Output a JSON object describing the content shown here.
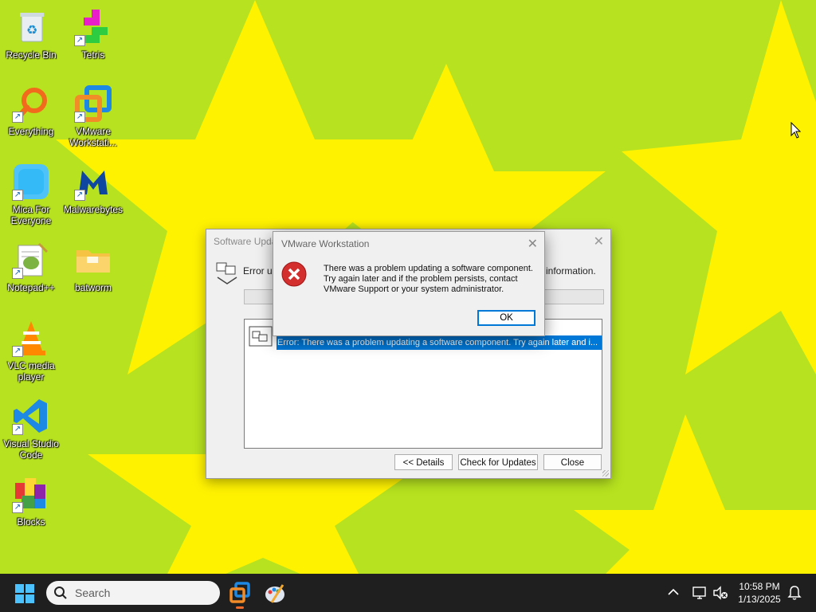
{
  "desktop": {
    "icons": [
      {
        "label": "Recycle Bin",
        "icon": "recycle-bin-icon"
      },
      {
        "label": "Tetris",
        "icon": "tetris-icon"
      },
      {
        "label": "Everything",
        "icon": "everything-search-icon"
      },
      {
        "label": "VMware\nWorkstati...",
        "icon": "vmware-workstation-icon"
      },
      {
        "label": "Mica For\nEveryone",
        "icon": "mica-icon"
      },
      {
        "label": "Malwarebytes",
        "icon": "malwarebytes-icon"
      },
      {
        "label": "Notepad++",
        "icon": "notepad-plus-plus-icon"
      },
      {
        "label": "batworm",
        "icon": "folder-icon"
      },
      {
        "label": "VLC media\nplayer",
        "icon": "vlc-icon"
      },
      {
        "label": "Visual Studio\nCode",
        "icon": "vscode-icon"
      },
      {
        "label": "Blocks",
        "icon": "blocks-icon"
      }
    ]
  },
  "updates_window": {
    "title": "Software Upda",
    "message": "Error up",
    "message_tail": "information.",
    "list_item": "Error: There was a problem updating a software component. Try again later and i...",
    "buttons": {
      "details": "<< Details",
      "check": "Check for Updates",
      "close": "Close"
    }
  },
  "error_dialog": {
    "title": "VMware Workstation",
    "message_lines": [
      "There was a problem updating a software component.",
      "Try again later and if the problem persists, contact",
      "VMware Support or your system administrator."
    ],
    "ok_label": "OK"
  },
  "taskbar": {
    "search_placeholder": "Search",
    "clock": {
      "time": "10:58 PM",
      "date": "1/13/2025"
    },
    "apps": [
      "vmware-workstation",
      "paint-tool"
    ]
  },
  "colors": {
    "wallpaper_green": "#b6e21f",
    "wallpaper_yellow": "#fff200",
    "taskbar": "#1f1f1f",
    "selection": "#0078d7",
    "error_red": "#d32f2f"
  }
}
